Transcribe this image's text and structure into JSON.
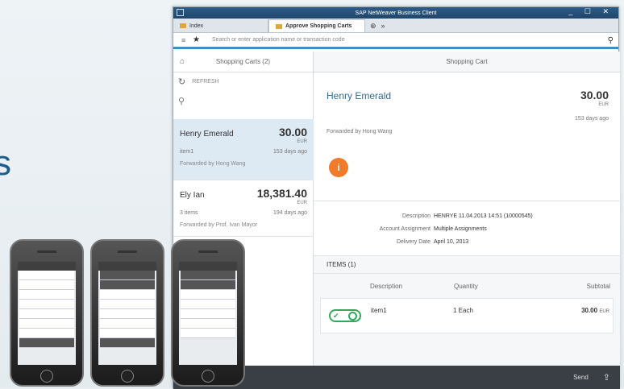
{
  "window": {
    "title": "SAP NetWeaver Business Client",
    "controls": "_ ☐ ✕"
  },
  "tabs": [
    {
      "label": "Index"
    },
    {
      "label": "Approve Shopping Carts"
    }
  ],
  "search": {
    "placeholder": "Search or enter application name or transaction code"
  },
  "left_pane": {
    "title": "Shopping Carts (2)",
    "refresh_label": "REFRESH",
    "items": [
      {
        "name": "Henry Emerald",
        "amount": "30.00",
        "currency": "EUR",
        "desc": "item1",
        "age": "153 days ago",
        "forwarded": "Forwarded by Hong Wang"
      },
      {
        "name": "Ely Ian",
        "amount": "18,381.40",
        "currency": "EUR",
        "desc": "3 items",
        "age": "194 days ago",
        "forwarded": "Forwarded by Prof. Ivan Mayor"
      }
    ]
  },
  "right_pane": {
    "title": "Shopping Cart",
    "name": "Henry Emerald",
    "amount": "30.00",
    "currency": "EUR",
    "age": "153 days ago",
    "forwarded": "Forwarded by Hong Wang",
    "badge": "i",
    "info": [
      {
        "key": "Description",
        "value": "HENRYE 11.04.2013 14:51 (10000545)"
      },
      {
        "key": "Account Assignment",
        "value": "Multiple Assignments"
      },
      {
        "key": "Delivery Date",
        "value": "April 10, 2013"
      }
    ],
    "items_header": "ITEMS (1)",
    "columns": {
      "description": "Description",
      "quantity": "Quantity",
      "subtotal": "Subtotal"
    },
    "rows": [
      {
        "name": "item1",
        "quantity": "1 Each",
        "subtotal": "30.00",
        "currency": "EUR"
      }
    ]
  },
  "footer": {
    "send_label": "Send"
  },
  "slide": {
    "letter": "s"
  },
  "colors": {
    "accent": "#3c8fc0",
    "badge": "#f07b2b",
    "approve": "#3aa55a"
  }
}
